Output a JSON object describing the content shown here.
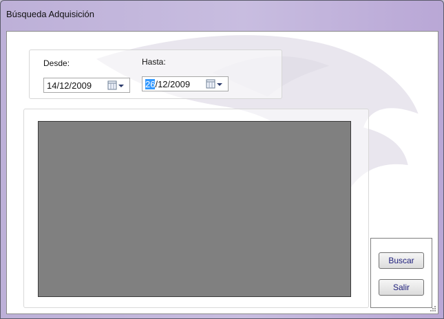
{
  "window": {
    "title": "Búsqueda Adquisición"
  },
  "dates": {
    "desde_label": "Desde:",
    "hasta_label": "Hasta:",
    "desde_value": "14/12/2009",
    "hasta_value_selected": "26",
    "hasta_value_rest": "/12/2009"
  },
  "actions": {
    "buscar": "Buscar",
    "salir": "Salir"
  },
  "colors": {
    "title_bar": "#c8bde0",
    "grid_background": "#808080",
    "selection": "#3399ff",
    "button_text": "#1c1c7a"
  },
  "icons": {
    "calendar": "calendar-icon",
    "dropdown": "chevron-down-icon",
    "resize": "resize-grip-icon"
  }
}
